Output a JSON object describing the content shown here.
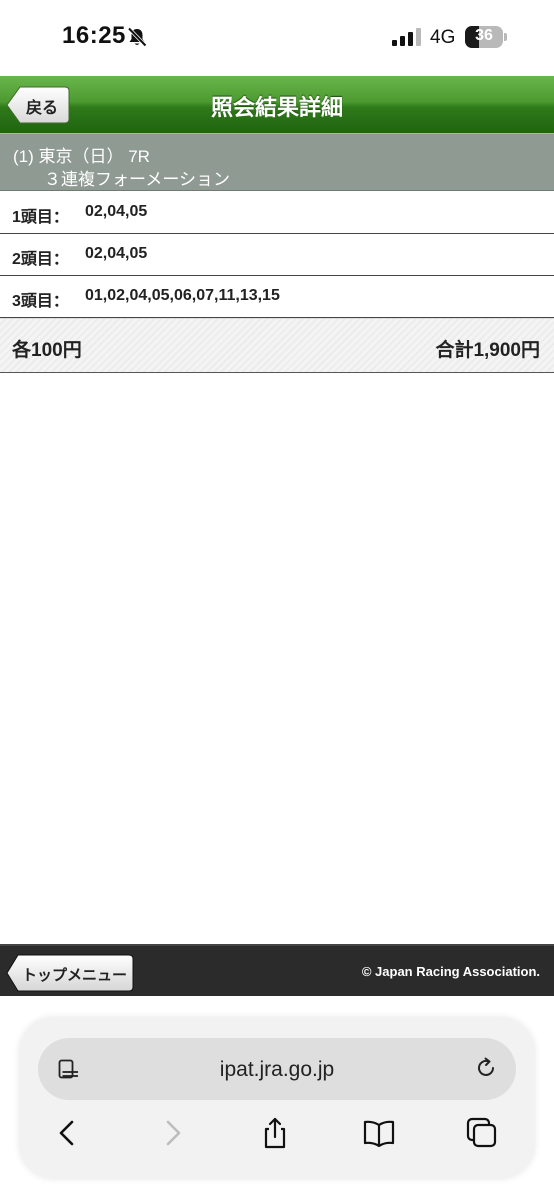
{
  "status_bar": {
    "time": "16:25",
    "network": "4G",
    "battery_level": "36",
    "battery_fraction": 0.36
  },
  "header": {
    "back_label": "戻る",
    "title": "照会結果詳細"
  },
  "race": {
    "line1": "(1) 東京（日） 7R",
    "line2": "３連複フォーメーション"
  },
  "rows": [
    {
      "label": "1頭目：",
      "value": "02,04,05"
    },
    {
      "label": "2頭目：",
      "value": "02,04,05"
    },
    {
      "label": "3頭目：",
      "value": "01,02,04,05,06,07,11,13,15"
    }
  ],
  "summary": {
    "unit": "各100円",
    "total": "合計1,900円"
  },
  "footer": {
    "top_menu_label": "トップメニュー",
    "copyright": "© Japan Racing Association."
  },
  "browser": {
    "url": "ipat.jra.go.jp"
  },
  "colors": {
    "header_green": "#4c9a30",
    "race_bar": "#8e9a92",
    "footer": "#2b2b2b"
  },
  "icons": [
    "bell-slash-icon",
    "signal-icon",
    "battery-icon",
    "tab-list-icon",
    "reload-icon",
    "back-chevron-icon",
    "forward-chevron-icon",
    "share-icon",
    "bookmarks-icon",
    "tabs-icon"
  ]
}
